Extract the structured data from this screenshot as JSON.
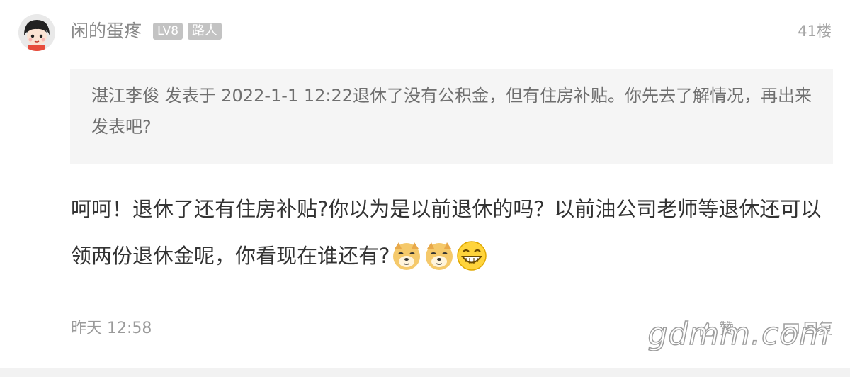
{
  "post": {
    "username": "闲的蛋疼",
    "level_badge": "LV8",
    "rank_badge": "路人",
    "floor": "41楼",
    "quote": "湛江李俊 发表于 2022-1-1 12:22退休了没有公积金，但有住房补贴。你先去了解情况，再出来发表吧?",
    "content": "呵呵！退休了还有住房补贴?你以为是以前退休的吗？以前油公司老师等退休还可以领两份退休金呢，你看现在谁还有?",
    "emojis": [
      "doge-emoji",
      "doge-emoji",
      "grin-emoji"
    ],
    "timestamp": "昨天 12:58",
    "like_label": "赞",
    "reply_label": "回复"
  },
  "watermark": "gdmm.com",
  "colors": {
    "username": "#8a8a8a",
    "badge_bg": "#c3c3c3",
    "quote_bg": "#f5f5f5",
    "content": "#333333"
  }
}
